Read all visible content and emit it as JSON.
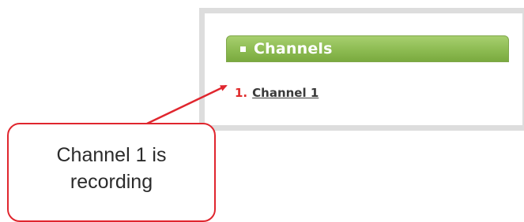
{
  "sidebar": {
    "header_title": "Channels",
    "channels": [
      {
        "number": "1.",
        "label": "Channel 1"
      }
    ]
  },
  "callout": {
    "line1": "Channel 1 is",
    "line2": "recording"
  },
  "colors": {
    "header_green": "#8dbb52",
    "channel_number_red": "#e02b2b",
    "annotation_red": "#e0262e",
    "panel_border": "#dddddd"
  }
}
